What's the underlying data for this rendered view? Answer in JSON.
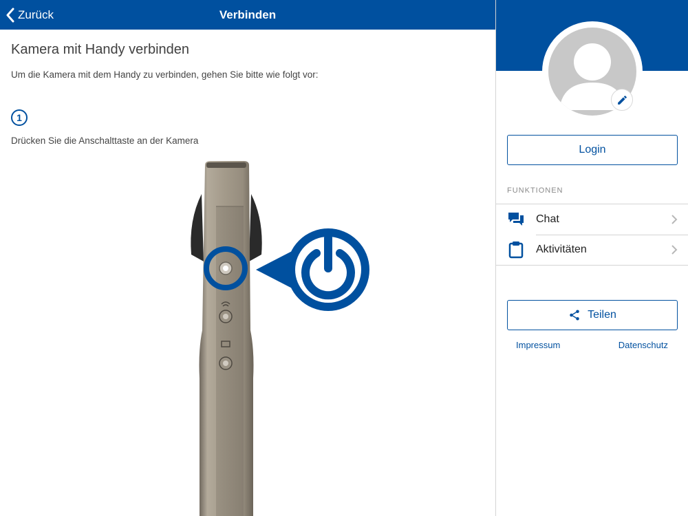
{
  "navbar": {
    "back_label": "Zurück",
    "title": "Verbinden"
  },
  "content": {
    "title": "Kamera mit Handy verbinden",
    "intro": "Um die Kamera mit dem Handy zu verbinden, gehen Sie bitte wie folgt vor:",
    "step_number": "1",
    "step_text": "Drücken Sie die Anschalttaste an der Kamera"
  },
  "sidebar": {
    "login_label": "Login",
    "section_label": "FUNKTIONEN",
    "menu": [
      {
        "label": "Chat",
        "icon": "chat-icon"
      },
      {
        "label": "Aktivitäten",
        "icon": "clipboard-icon"
      }
    ],
    "share_label": "Teilen",
    "impressum_label": "Impressum",
    "datenschutz_label": "Datenschutz"
  },
  "colors": {
    "brand_blue": "#00509f",
    "avatar_gray": "#c8c8c8",
    "camera_body": "#a59b8c"
  }
}
